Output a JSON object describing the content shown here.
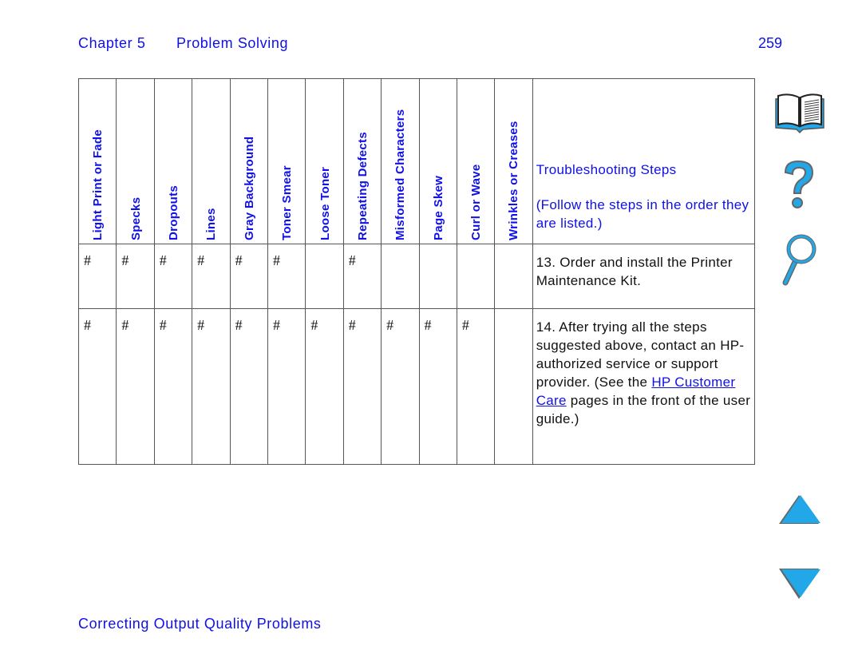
{
  "header": {
    "chapter": "Chapter 5",
    "chapter_title": "Problem Solving",
    "page_number": "259"
  },
  "table": {
    "columns": [
      "Light Print or Fade",
      "Specks",
      "Dropouts",
      "Lines",
      "Gray Background",
      "Toner Smear",
      "Loose Toner",
      "Repeating Defects",
      "Misformed Characters",
      "Page Skew",
      "Curl or Wave",
      "Wrinkles or Creases"
    ],
    "steps_header": {
      "title": "Troubleshooting Steps",
      "subtitle": "(Follow the steps in the order they are listed.)"
    },
    "mark_symbol": "#",
    "rows": [
      {
        "marks": [
          true,
          true,
          true,
          true,
          true,
          true,
          false,
          true,
          false,
          false,
          false,
          false
        ],
        "step": "13. Order and install the Printer Maintenance Kit."
      },
      {
        "marks": [
          true,
          true,
          true,
          true,
          true,
          true,
          true,
          true,
          true,
          true,
          true,
          false
        ],
        "step_before_link": "14. After trying all the steps suggested above, contact an HP-authorized service or support provider. (See the ",
        "step_link": "HP Customer Care",
        "step_after_link": " pages in the front of the user guide.)"
      }
    ]
  },
  "nav_icons": {
    "contents": "book-icon",
    "help": "question-mark-icon",
    "search": "magnifier-icon",
    "previous": "up-triangle-icon",
    "next": "down-triangle-icon"
  },
  "colors": {
    "text_blue": "#1010e8",
    "icon_blue": "#22a8e8"
  },
  "footer": {
    "section": "Correcting Output Quality Problems"
  }
}
